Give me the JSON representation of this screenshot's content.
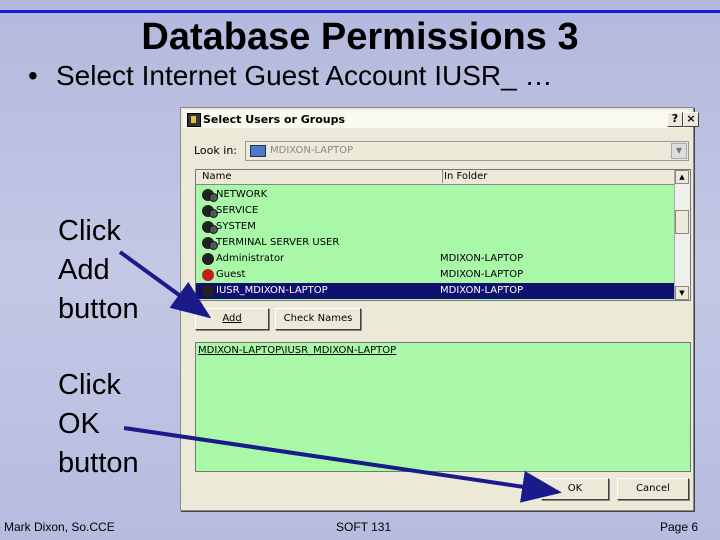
{
  "slide": {
    "title": "Database Permissions 3",
    "bullet": "Select Internet Guest Account IUSR_ …",
    "callout_add": [
      "Click",
      "Add",
      "button"
    ],
    "callout_ok": [
      "Click",
      "OK",
      "button"
    ],
    "footer_left": "Mark Dixon, So.CCE",
    "footer_center": "SOFT 131",
    "footer_right": "Page 6"
  },
  "dialog": {
    "title": "Select Users or Groups",
    "help_label": "?",
    "close_label": "×",
    "look_in_label": "Look in:",
    "look_in_value": "MDIXON-LAPTOP",
    "columns": {
      "name": "Name",
      "folder": "In Folder"
    },
    "rows": [
      {
        "name": "NETWORK",
        "folder": "",
        "icon": "group-icon"
      },
      {
        "name": "SERVICE",
        "folder": "",
        "icon": "group-icon"
      },
      {
        "name": "SYSTEM",
        "folder": "",
        "icon": "group-icon"
      },
      {
        "name": "TERMINAL SERVER USER",
        "folder": "",
        "icon": "group-icon"
      },
      {
        "name": "Administrator",
        "folder": "MDIXON-LAPTOP",
        "icon": "user-icon"
      },
      {
        "name": "Guest",
        "folder": "MDIXON-LAPTOP",
        "icon": "guest-user-icon"
      },
      {
        "name": "IUSR_MDIXON-LAPTOP",
        "folder": "MDIXON-LAPTOP",
        "icon": "user-icon",
        "selected": true
      }
    ],
    "add_button": "Add",
    "check_names_button": "Check Names",
    "selected_value": "MDIXON-LAPTOP\\IUSR_MDIXON-LAPTOP",
    "ok_button": "OK",
    "cancel_button": "Cancel"
  },
  "colors": {
    "list_background": "#a8f8a8",
    "selection": "#10106e",
    "arrow": "#1a1a8a",
    "title_rule": "#1a1adb"
  }
}
